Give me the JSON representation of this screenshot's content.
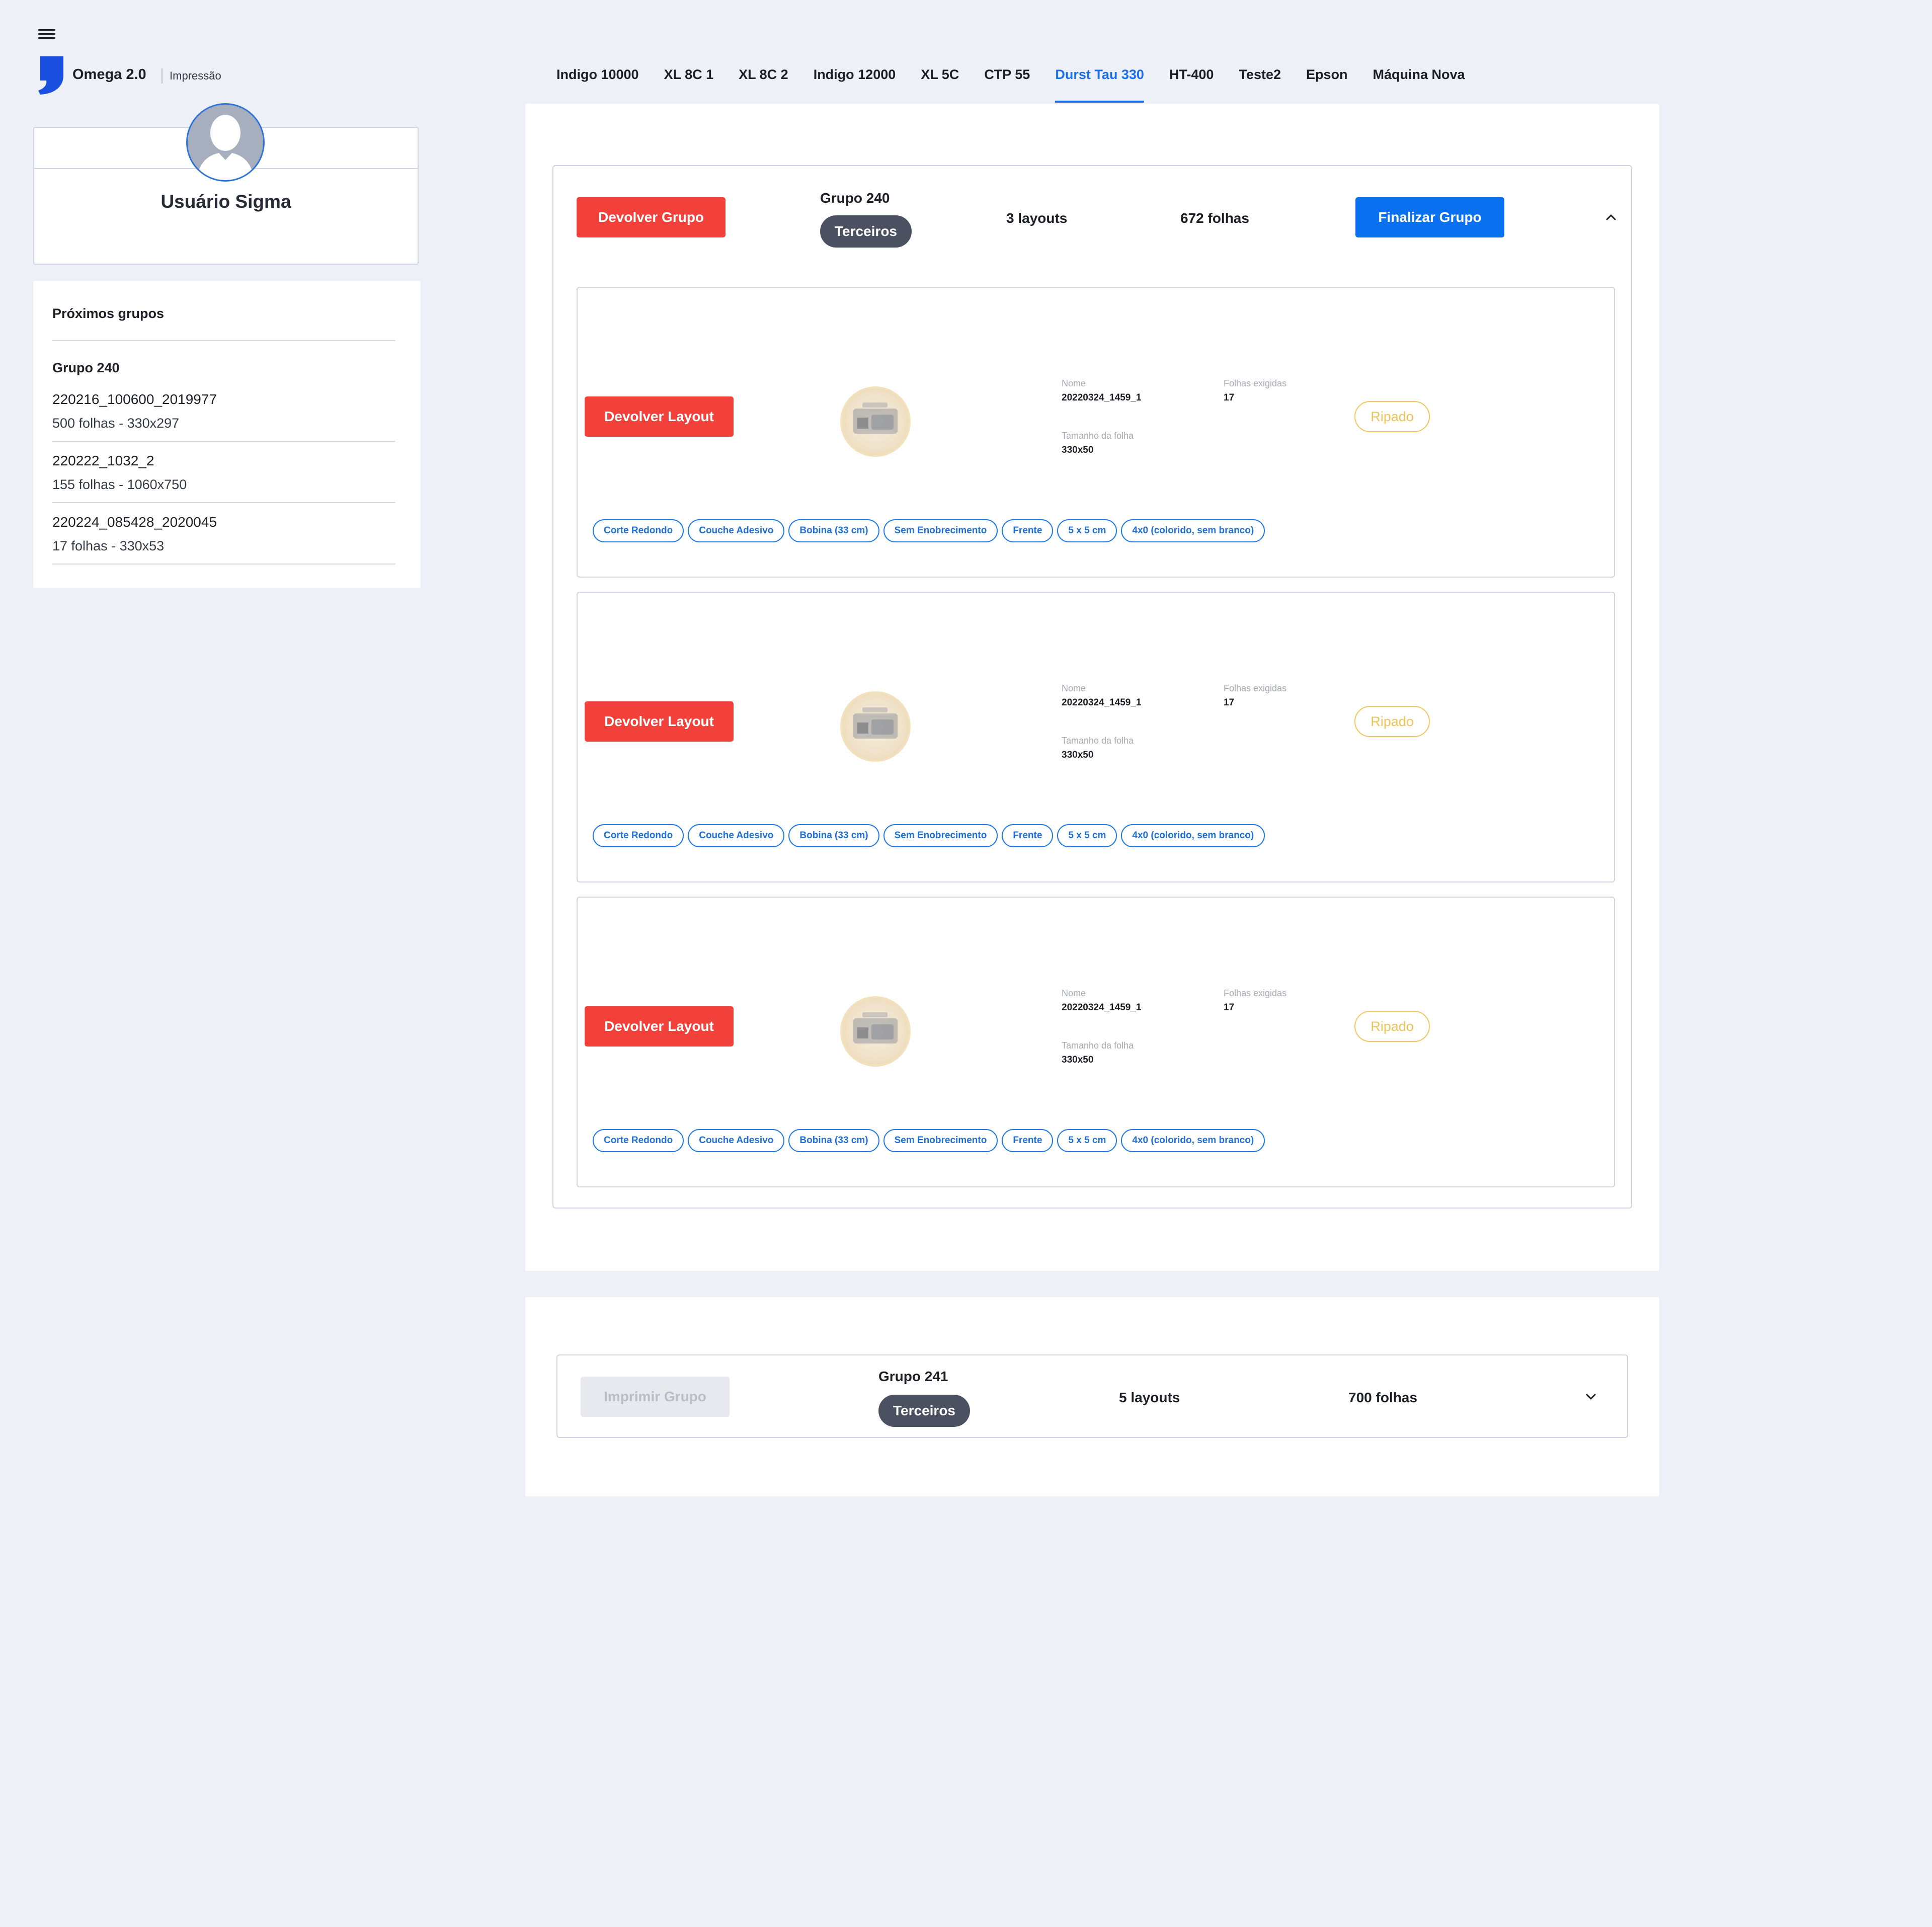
{
  "app": {
    "name": "Omega 2.0",
    "section": "Impressão"
  },
  "tabs": [
    {
      "label": "Indigo 10000",
      "active": false
    },
    {
      "label": "XL 8C 1",
      "active": false
    },
    {
      "label": "XL 8C 2",
      "active": false
    },
    {
      "label": "Indigo 12000",
      "active": false
    },
    {
      "label": "XL 5C",
      "active": false
    },
    {
      "label": "CTP 55",
      "active": false
    },
    {
      "label": "Durst Tau 330",
      "active": true
    },
    {
      "label": "HT-400",
      "active": false
    },
    {
      "label": "Teste2",
      "active": false
    },
    {
      "label": "Epson",
      "active": false
    },
    {
      "label": "Máquina Nova",
      "active": false
    }
  ],
  "profile": {
    "name": "Usuário Sigma"
  },
  "next_groups": {
    "title": "Próximos grupos",
    "group": "Grupo 240",
    "items": [
      {
        "code": "220216_100600_2019977",
        "meta": "500 folhas - 330x297"
      },
      {
        "code": "220222_1032_2",
        "meta": "155 folhas - 1060x750"
      },
      {
        "code": "220224_085428_2020045",
        "meta": "17 folhas - 330x53"
      }
    ]
  },
  "group_240": {
    "return_label": "Devolver Grupo",
    "name": "Grupo 240",
    "type": "Terceiros",
    "layouts": "3 layouts",
    "sheets": "672 folhas",
    "finish_label": "Finalizar Grupo",
    "expanded": true,
    "layouts_list": [
      {
        "return_label": "Devolver Layout",
        "name_label": "Nome",
        "name": "20220324_1459_1",
        "required_label": "Folhas exigidas",
        "required": "17",
        "size_label": "Tamanho da folha",
        "size": "330x50",
        "status": "Ripado",
        "tags": [
          "Corte Redondo",
          "Couche Adesivo",
          "Bobina (33 cm)",
          "Sem Enobrecimento",
          "Frente",
          "5 x 5 cm",
          "4x0 (colorido, sem branco)"
        ]
      },
      {
        "return_label": "Devolver Layout",
        "name_label": "Nome",
        "name": "20220324_1459_1",
        "required_label": "Folhas exigidas",
        "required": "17",
        "size_label": "Tamanho da folha",
        "size": "330x50",
        "status": "Ripado",
        "tags": [
          "Corte Redondo",
          "Couche Adesivo",
          "Bobina (33 cm)",
          "Sem Enobrecimento",
          "Frente",
          "5 x 5 cm",
          "4x0 (colorido, sem branco)"
        ]
      },
      {
        "return_label": "Devolver Layout",
        "name_label": "Nome",
        "name": "20220324_1459_1",
        "required_label": "Folhas exigidas",
        "required": "17",
        "size_label": "Tamanho da folha",
        "size": "330x50",
        "status": "Ripado",
        "tags": [
          "Corte Redondo",
          "Couche Adesivo",
          "Bobina (33 cm)",
          "Sem Enobrecimento",
          "Frente",
          "5 x 5 cm",
          "4x0 (colorido, sem branco)"
        ]
      }
    ]
  },
  "group_241": {
    "print_label": "Imprimir Grupo",
    "name": "Grupo 241",
    "type": "Terceiros",
    "layouts": "5 layouts",
    "sheets": "700 folhas",
    "expanded": false
  },
  "colors": {
    "accent": "#1b6fe8",
    "danger": "#f2413a",
    "primary_button": "#0a72f0",
    "status_ripado": "#efc255",
    "background": "#edf0f7"
  }
}
